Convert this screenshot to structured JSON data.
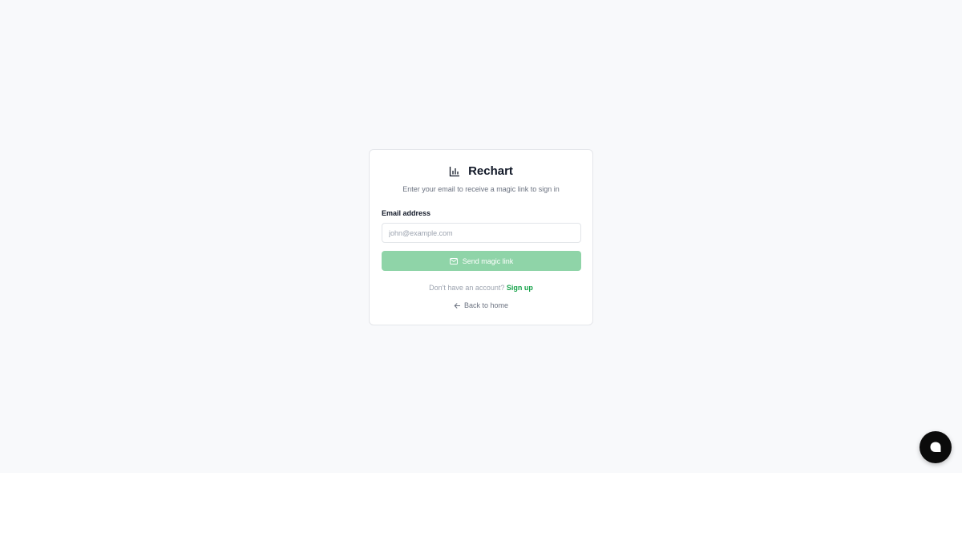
{
  "colors": {
    "page_background": "#f8f9fb",
    "accent": "#16a34a",
    "button_disabled": "#8fd4a8",
    "chat_button": "#0b0b0b"
  },
  "brand": {
    "name": "Rechart",
    "icon": "bar-chart-icon"
  },
  "login": {
    "subtitle": "Enter your email to receive a magic link to sign in",
    "email_label": "Email address",
    "email_value": "",
    "email_placeholder": "john@example.com",
    "send_button_label": "Send magic link",
    "send_button_icon": "mail-icon",
    "signup_prompt": "Don't have an account?",
    "signup_link": "Sign up",
    "back_link": "Back to home",
    "back_icon": "arrow-left-icon"
  },
  "chat_widget": {
    "icon": "chat-bubble-icon"
  }
}
